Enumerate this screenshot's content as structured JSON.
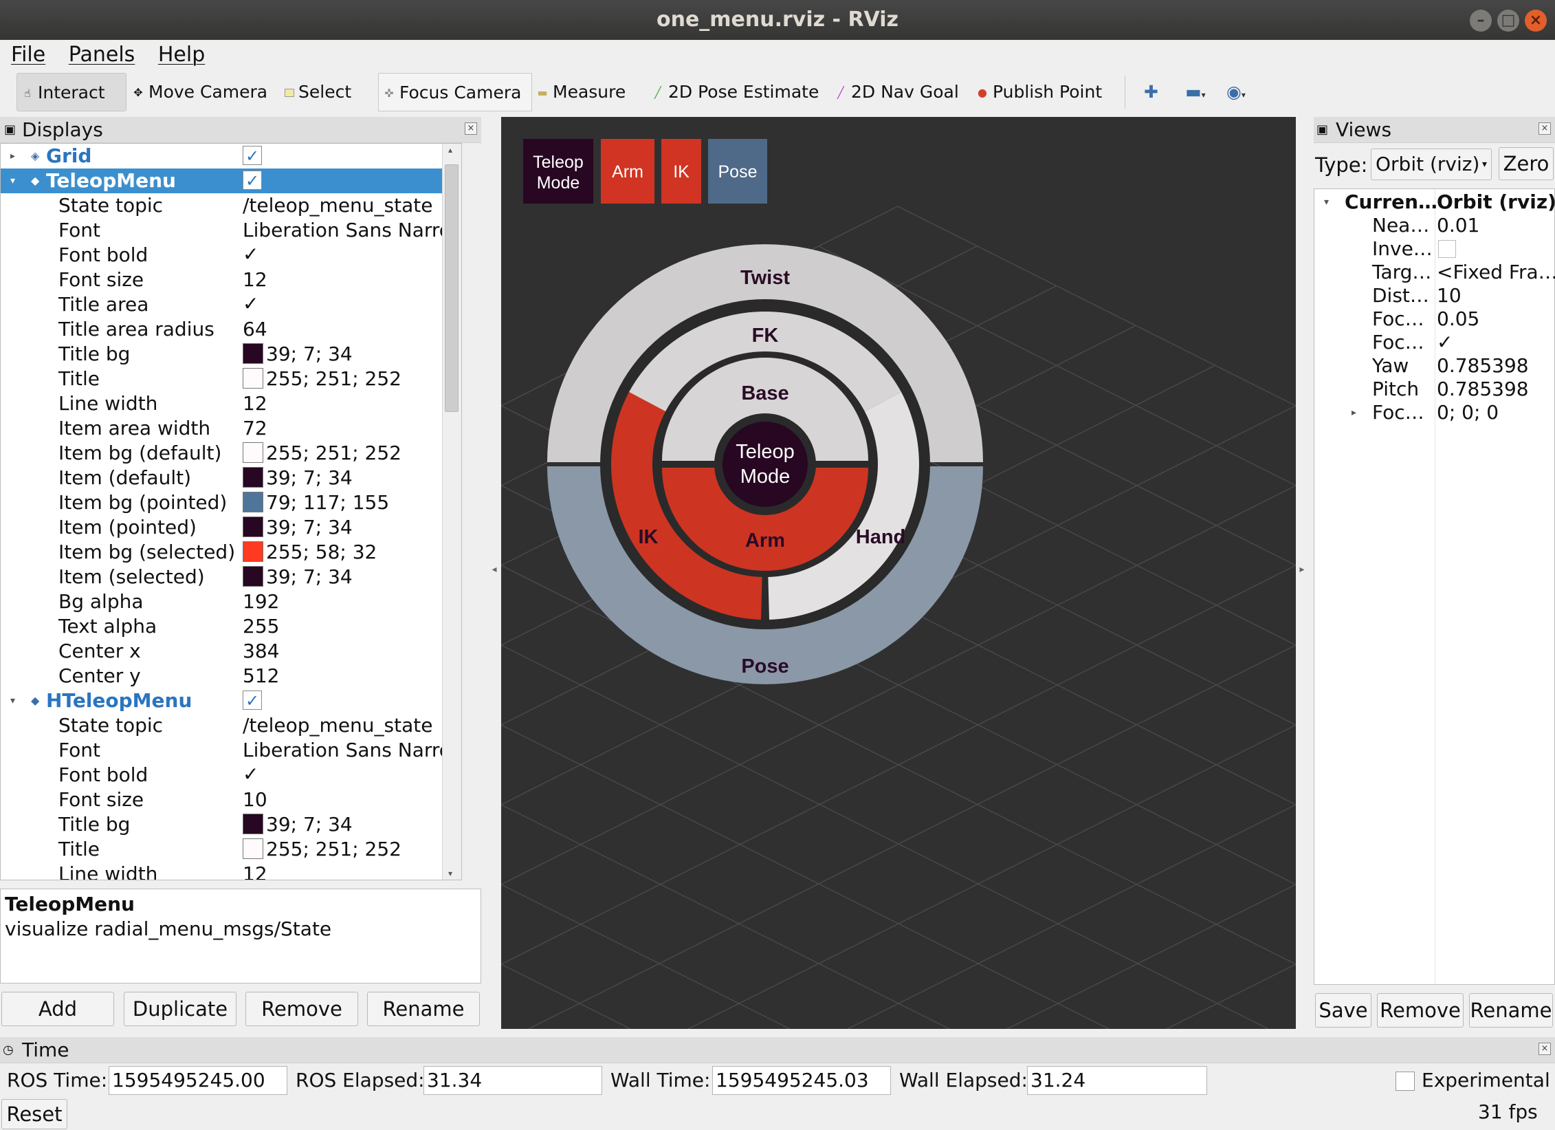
{
  "window": {
    "title": "one_menu.rviz - RViz"
  },
  "menubar": {
    "file": "File",
    "panels": "Panels",
    "help": "Help"
  },
  "toolbar": {
    "interact": "Interact",
    "move_camera": "Move Camera",
    "select": "Select",
    "focus_camera": "Focus Camera",
    "measure": "Measure",
    "pose_estimate": "2D Pose Estimate",
    "nav_goal": "2D Nav Goal",
    "publish_point": "Publish Point"
  },
  "displays": {
    "title": "Displays",
    "grid": {
      "name": "Grid"
    },
    "teleop": {
      "name": "TeleopMenu",
      "props": [
        {
          "label": "State topic",
          "value": "/teleop_menu_state"
        },
        {
          "label": "Font",
          "value": "Liberation Sans Narrow"
        },
        {
          "label": "Font bold",
          "value": "✓"
        },
        {
          "label": "Font size",
          "value": "12"
        },
        {
          "label": "Title area",
          "value": "✓"
        },
        {
          "label": "Title area radius",
          "value": "64"
        },
        {
          "label": "Title bg",
          "value": "39; 7; 34",
          "color": "#270722"
        },
        {
          "label": "Title",
          "value": "255; 251; 252",
          "color": "#fffbfc"
        },
        {
          "label": "Line width",
          "value": "12"
        },
        {
          "label": "Item area width",
          "value": "72"
        },
        {
          "label": "Item bg (default)",
          "value": "255; 251; 252",
          "color": "#fffbfc"
        },
        {
          "label": "Item (default)",
          "value": "39; 7; 34",
          "color": "#270722"
        },
        {
          "label": "Item bg (pointed)",
          "value": "79; 117; 155",
          "color": "#4f759b"
        },
        {
          "label": "Item (pointed)",
          "value": "39; 7; 34",
          "color": "#270722"
        },
        {
          "label": "Item bg (selected)",
          "value": "255; 58; 32",
          "color": "#ff3a20"
        },
        {
          "label": "Item (selected)",
          "value": "39; 7; 34",
          "color": "#270722"
        },
        {
          "label": "Bg alpha",
          "value": "192"
        },
        {
          "label": "Text alpha",
          "value": "255"
        },
        {
          "label": "Center x",
          "value": "384"
        },
        {
          "label": "Center y",
          "value": "512"
        }
      ]
    },
    "hteleop": {
      "name": "HTeleopMenu",
      "props": [
        {
          "label": "State topic",
          "value": "/teleop_menu_state"
        },
        {
          "label": "Font",
          "value": "Liberation Sans Narrow"
        },
        {
          "label": "Font bold",
          "value": "✓"
        },
        {
          "label": "Font size",
          "value": "10"
        },
        {
          "label": "Title bg",
          "value": "39; 7; 34",
          "color": "#270722"
        },
        {
          "label": "Title",
          "value": "255; 251; 252",
          "color": "#fffbfc"
        },
        {
          "label": "Line width",
          "value": "12"
        }
      ]
    },
    "description": {
      "name": "TeleopMenu",
      "text": "visualize radial_menu_msgs/State"
    },
    "buttons": {
      "add": "Add",
      "duplicate": "Duplicate",
      "remove": "Remove",
      "rename": "Rename"
    }
  },
  "viewport": {
    "hmenu": {
      "title": "Teleop\nMode",
      "items": [
        "Arm",
        "IK",
        "Pose"
      ]
    },
    "radial": {
      "title_line1": "Teleop",
      "title_line2": "Mode",
      "outer": {
        "top": "Twist",
        "bottom": "Pose"
      },
      "middle": {
        "top": "FK",
        "left": "IK",
        "right": "Hand"
      },
      "inner": {
        "top": "Base",
        "bottom": "Arm"
      }
    }
  },
  "views": {
    "title": "Views",
    "type_label": "Type:",
    "type_value": "Orbit (rviz)",
    "zero": "Zero",
    "current_key": "Curren…",
    "current_value": "Orbit (rviz)",
    "props": [
      {
        "key": "Nea…",
        "value": "0.01"
      },
      {
        "key": "Inve…",
        "value": ""
      },
      {
        "key": "Targ…",
        "value": "<Fixed Fra…"
      },
      {
        "key": "Dist…",
        "value": "10"
      },
      {
        "key": "Foc…",
        "value": "0.05"
      },
      {
        "key": "Foc…",
        "value": "✓"
      },
      {
        "key": "Yaw",
        "value": "0.785398"
      },
      {
        "key": "Pitch",
        "value": "0.785398"
      },
      {
        "key": "Foc…",
        "value": "0; 0; 0"
      }
    ],
    "buttons": {
      "save": "Save",
      "remove": "Remove",
      "rename": "Rename"
    }
  },
  "time": {
    "title": "Time",
    "ros_time_label": "ROS Time:",
    "ros_time": "1595495245.00",
    "ros_elapsed_label": "ROS Elapsed:",
    "ros_elapsed": "31.34",
    "wall_time_label": "Wall Time:",
    "wall_time": "1595495245.03",
    "wall_elapsed_label": "Wall Elapsed:",
    "wall_elapsed": "31.24",
    "experimental": "Experimental",
    "reset": "Reset",
    "fps": "31 fps"
  }
}
